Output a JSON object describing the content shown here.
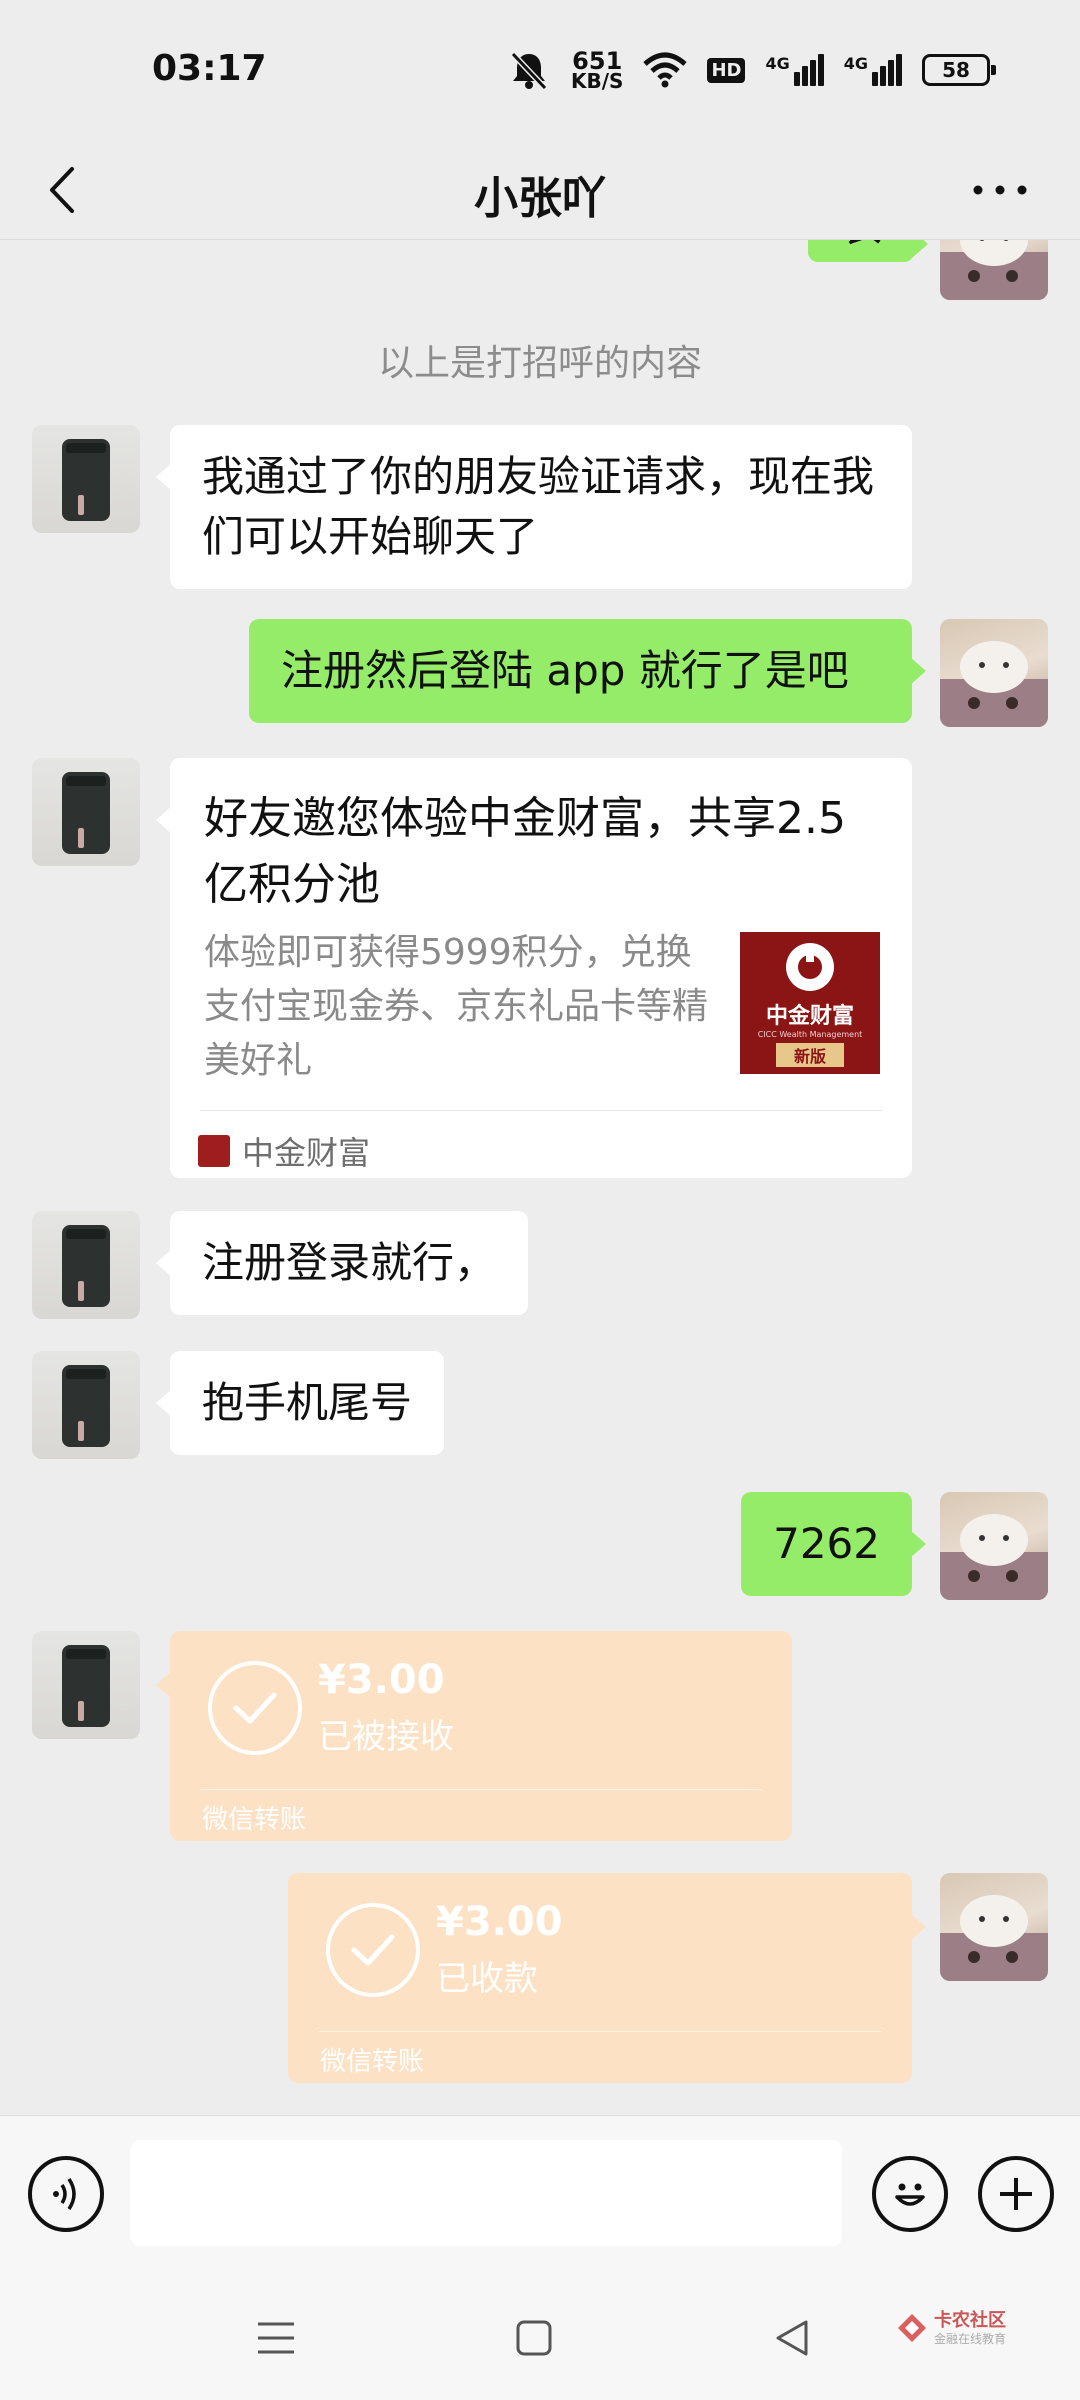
{
  "status_bar": {
    "time": "03:17",
    "net_speed_value": "651",
    "net_speed_unit": "KB/S",
    "hd_label": "HD",
    "signal1_label": "4G",
    "signal2_label": "4G",
    "battery": "58"
  },
  "header": {
    "title": "小张吖",
    "back_icon": "chevron-left-icon",
    "more_icon": "more-dots-icon"
  },
  "chat": {
    "partial_top_text": "衣",
    "system_notice": "以上是打招呼的内容",
    "msg1": "我通过了你的朋友验证请求，现在我们可以开始聊天了",
    "msg2": "注册然后登陆 app 就行了是吧",
    "card": {
      "title": "好友邀您体验中金财富，共享2.5亿积分池",
      "desc": "体验即可获得5999积分，兑换支付宝现金券、京东礼品卡等精美好礼",
      "thumb_brand": "中金财富",
      "thumb_sub": "CICC Wealth Management",
      "thumb_badge": "新版",
      "source": "中金财富"
    },
    "msg3": "注册登录就行，",
    "msg4": "抱手机尾号",
    "msg5": "7262",
    "transfer_in": {
      "amount": "¥3.00",
      "status": "已被接收",
      "footer": "微信转账"
    },
    "transfer_out": {
      "amount": "¥3.00",
      "status": "已收款",
      "footer": "微信转账"
    }
  },
  "input_bar": {
    "voice_icon": "voice-icon",
    "emoji_icon": "emoji-icon",
    "plus_icon": "plus-icon",
    "placeholder": ""
  },
  "nav_bar": {
    "menu_icon": "menu-icon",
    "home_icon": "home-square-icon",
    "back_icon": "back-triangle-icon"
  },
  "watermark": {
    "name": "卡农社区",
    "sub": "金融在线教育"
  }
}
